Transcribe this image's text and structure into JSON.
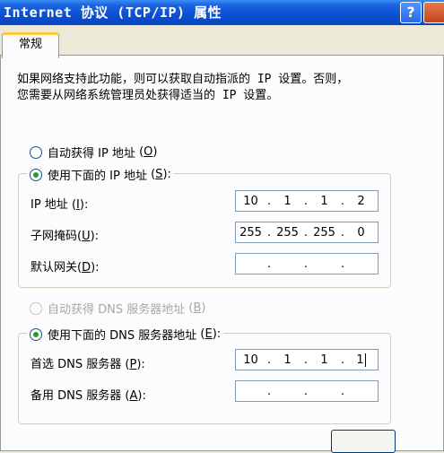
{
  "window": {
    "title": "Internet 协议 (TCP/IP) 属性",
    "help_glyph": "?"
  },
  "tabs": [
    {
      "label": "常规",
      "active": true
    }
  ],
  "description": {
    "line1": "如果网络支持此功能，则可以获取自动指派的 IP 设置。否则，",
    "line2": "您需要从网络系统管理员处获得适当的 IP 设置。"
  },
  "ip_section": {
    "auto_option": {
      "label": "自动获得 IP 地址",
      "key": "O",
      "selected": false
    },
    "manual_option": {
      "label": "使用下面的 IP 地址",
      "key": "S",
      "selected": true
    },
    "fields": [
      {
        "label": "IP 地址",
        "key": "I",
        "octets": [
          "10",
          "1",
          "1",
          "2"
        ]
      },
      {
        "label": "子网掩码",
        "key": "U",
        "octets": [
          "255",
          "255",
          "255",
          "0"
        ]
      },
      {
        "label": "默认网关",
        "key": "D",
        "octets": [
          "",
          "",
          "",
          ""
        ]
      }
    ]
  },
  "dns_section": {
    "auto_option": {
      "label": "自动获得 DNS 服务器地址",
      "key": "B",
      "selected": false,
      "disabled": true
    },
    "manual_option": {
      "label": "使用下面的 DNS 服务器地址",
      "key": "E",
      "selected": true
    },
    "fields": [
      {
        "label": "首选 DNS 服务器",
        "key": "P",
        "octets": [
          "10",
          "1",
          "1",
          "1"
        ]
      },
      {
        "label": "备用 DNS 服务器",
        "key": "A",
        "octets": [
          "",
          "",
          "",
          ""
        ]
      }
    ]
  },
  "colors": {
    "title_bar": "#0a4fd1",
    "dialog_bg": "#ece9d8",
    "panel_bg": "#fcfcfe",
    "radio_dot": "#21a121",
    "tab_highlight": "#ffc83c"
  }
}
